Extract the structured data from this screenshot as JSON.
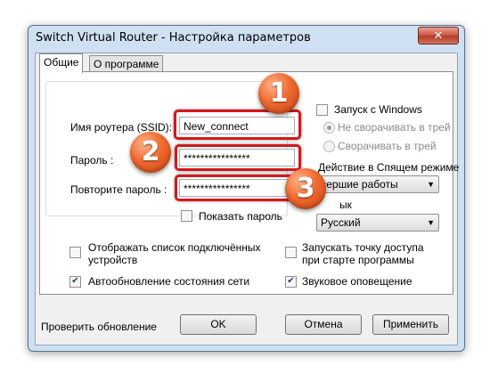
{
  "window": {
    "title": "Switch Virtual Router - Настройка параметров",
    "close_glyph": "✕"
  },
  "tabs": [
    "Общие",
    "О программе"
  ],
  "general": {
    "router_name_label": "Имя роутера (SSID):",
    "router_name_value": "New_connect",
    "password_label": "Пароль :",
    "password_value": "****************",
    "repeat_password_label": "Повторите пароль :",
    "repeat_password_value": "****************",
    "show_password_label": "Показать пароль",
    "startup_label": "Запуск с Windows",
    "radio_no_minimize": "Не сворачивать в трей",
    "radio_minimize": "Сворачивать в трей",
    "sleep_action_label": "Действие в Спящем режиме",
    "sleep_action_value": "вершие работы",
    "language_label": "ык",
    "language_value": "Русский",
    "show_devices_label_line1": "Отображать список подключённых",
    "show_devices_label_line2": "устройств",
    "autostart_ap_label_line1": "Запускать точку доступа",
    "autostart_ap_label_line2": "при старте программы",
    "auto_update_label": "Автообновление состояния сети",
    "sound_label": "Звуковое оповещение",
    "check_glyph": "✔"
  },
  "footer": {
    "check_update": "Проверить обновление",
    "ok": "OK",
    "cancel": "Отмена",
    "apply": "Применить"
  },
  "badges": [
    "1",
    "2",
    "3"
  ],
  "colors": {
    "highlight": "#d3181b",
    "badge": "#ef6a30",
    "window_frame": "#cfe0f3"
  }
}
